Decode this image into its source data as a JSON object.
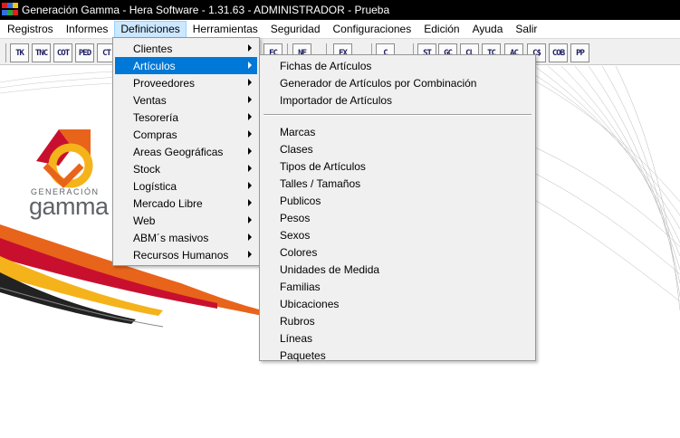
{
  "window": {
    "title": "Generación Gamma - Hera Software - 1.31.63 - ADMINISTRADOR - Prueba"
  },
  "menubar": {
    "items": [
      {
        "id": "registros",
        "label": "Registros"
      },
      {
        "id": "informes",
        "label": "Informes"
      },
      {
        "id": "definiciones",
        "label": "Definiciones",
        "open": true
      },
      {
        "id": "herramientas",
        "label": "Herramientas"
      },
      {
        "id": "seguridad",
        "label": "Seguridad"
      },
      {
        "id": "configuraciones",
        "label": "Configuraciones"
      },
      {
        "id": "edicion",
        "label": "Edición"
      },
      {
        "id": "ayuda",
        "label": "Ayuda"
      },
      {
        "id": "salir",
        "label": "Salir"
      }
    ]
  },
  "toolbar": {
    "buttons": [
      {
        "id": "tk",
        "label": "TK"
      },
      {
        "id": "tnc",
        "label": "TNC"
      },
      {
        "id": "cot",
        "label": "COT"
      },
      {
        "id": "ped",
        "label": "PED"
      },
      {
        "id": "ct",
        "label": "CT"
      },
      {
        "id": "fc",
        "label": "FC"
      },
      {
        "id": "nf",
        "label": "NF"
      },
      {
        "id": "ex",
        "label": "EX"
      },
      {
        "id": "c",
        "label": "C"
      },
      {
        "id": "st",
        "label": "ST"
      },
      {
        "id": "gc",
        "label": "GC"
      },
      {
        "id": "cl",
        "label": "CL"
      },
      {
        "id": "tc",
        "label": "TC"
      },
      {
        "id": "ac",
        "label": "AC"
      },
      {
        "id": "cs",
        "label": "C$"
      },
      {
        "id": "cob",
        "label": "COB"
      },
      {
        "id": "pp",
        "label": "PP"
      }
    ]
  },
  "logo": {
    "line1": "GENERACIÓN",
    "line2": "gamma"
  },
  "definiciones_menu": {
    "items": [
      {
        "label": "Clientes",
        "submenu": true
      },
      {
        "label": "Artículos",
        "submenu": true,
        "highlighted": true
      },
      {
        "label": "Proveedores",
        "submenu": true
      },
      {
        "label": "Ventas",
        "submenu": true
      },
      {
        "label": "Tesorería",
        "submenu": true
      },
      {
        "label": "Compras",
        "submenu": true
      },
      {
        "label": "Areas Geográficas",
        "submenu": true
      },
      {
        "label": "Stock",
        "submenu": true
      },
      {
        "label": "Logística",
        "submenu": true
      },
      {
        "label": "Mercado Libre",
        "submenu": true
      },
      {
        "label": "Web",
        "submenu": true
      },
      {
        "label": "ABM´s masivos",
        "submenu": true
      },
      {
        "label": "Recursos Humanos",
        "submenu": true
      }
    ]
  },
  "articulos_menu": {
    "group1": [
      {
        "label": "Fichas de Artículos"
      },
      {
        "label": "Generador de Artículos por Combinación"
      },
      {
        "label": "Importador de Artículos"
      }
    ],
    "group2": [
      {
        "label": "Marcas"
      },
      {
        "label": "Clases"
      },
      {
        "label": "Tipos de Artículos"
      },
      {
        "label": "Talles / Tamaños"
      },
      {
        "label": "Publicos"
      },
      {
        "label": "Pesos"
      },
      {
        "label": "Sexos"
      },
      {
        "label": "Colores"
      },
      {
        "label": "Unidades de Medida"
      },
      {
        "label": "Familias"
      },
      {
        "label": "Ubicaciones"
      },
      {
        "label": "Rubros"
      },
      {
        "label": "Líneas"
      },
      {
        "label": "Paquetes"
      }
    ]
  },
  "colors": {
    "highlight": "#0078d7",
    "menubar_open": "#cce8ff",
    "brand_orange": "#e8641b",
    "brand_red": "#c8102e",
    "brand_yellow": "#f5b31b"
  }
}
